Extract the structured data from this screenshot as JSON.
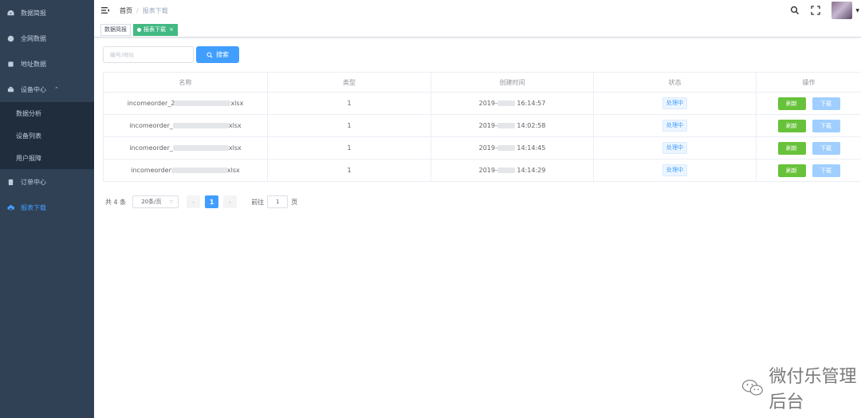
{
  "sidebar": {
    "items": [
      {
        "label": "数据简报",
        "icon": "dashboard-icon"
      },
      {
        "label": "全网数据",
        "icon": "globe-icon"
      },
      {
        "label": "地址数据",
        "icon": "database-icon"
      },
      {
        "label": "设备中心",
        "icon": "device-icon",
        "expanded": true,
        "children": [
          "数据分析",
          "设备列表",
          "用户报障"
        ]
      },
      {
        "label": "订单中心",
        "icon": "order-icon"
      },
      {
        "label": "报表下载",
        "icon": "cloud-download-icon",
        "active": true
      }
    ]
  },
  "navbar": {
    "breadcrumb": {
      "home": "首页",
      "separator": "/",
      "current": "报表下载"
    }
  },
  "tags": [
    {
      "label": "数据简报",
      "active": false
    },
    {
      "label": "报表下载",
      "active": true,
      "close": "×"
    }
  ],
  "search": {
    "placeholder": "编号/地址",
    "value": "",
    "button_label": "搜索"
  },
  "table": {
    "headers": [
      "名称",
      "类型",
      "创建时间",
      "状态",
      "操作"
    ],
    "rows": [
      {
        "name_prefix": "incomeorder_2",
        "name_suffix": "xlsx",
        "type": "1",
        "time_prefix": "2019-",
        "time_suffix": "16:14:57",
        "status": "处理中",
        "refresh": "刷新",
        "download": "下载"
      },
      {
        "name_prefix": "incomeorder_",
        "name_suffix": "xlsx",
        "type": "1",
        "time_prefix": "2019-",
        "time_suffix": "14:02:58",
        "status": "处理中",
        "refresh": "刷新",
        "download": "下载"
      },
      {
        "name_prefix": "incomeorder_",
        "name_suffix": "xlsx",
        "type": "1",
        "time_prefix": "2019-",
        "time_suffix": "14:14:45",
        "status": "处理中",
        "refresh": "刷新",
        "download": "下载"
      },
      {
        "name_prefix": "incomeorder",
        "name_suffix": "xlsx",
        "type": "1",
        "time_prefix": "2019-",
        "time_suffix": "14:14:29",
        "status": "处理中",
        "refresh": "刷新",
        "download": "下载"
      }
    ]
  },
  "pagination": {
    "total": "共 4 条",
    "page_size": "20条/页",
    "prev": "‹",
    "current": "1",
    "next": "›",
    "goto_label": "前往",
    "goto_value": "1",
    "goto_suffix": "页"
  },
  "watermark": {
    "text": "微付乐管理后台"
  },
  "colors": {
    "sidebar_bg": "#304156",
    "submenu_bg": "#1f2d3d",
    "primary": "#409eff",
    "success": "#67c23a",
    "tag_active": "#42b983"
  }
}
